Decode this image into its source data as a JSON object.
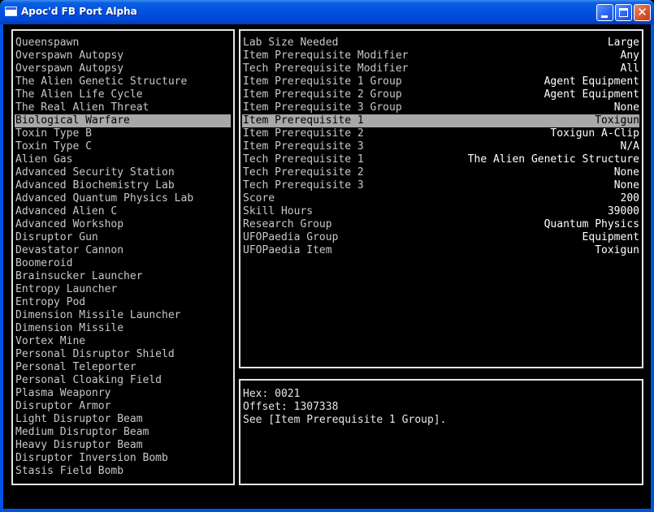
{
  "window": {
    "title": "Apoc'd FB Port Alpha"
  },
  "research_list": {
    "selected_index": 6,
    "items": [
      "Queenspawn",
      "Overspawn Autopsy",
      "Overspawn Autopsy",
      "The Alien Genetic Structure",
      "The Alien Life Cycle",
      "The Real Alien Threat",
      "Biological Warfare",
      "Toxin Type B",
      "Toxin Type C",
      "Alien Gas",
      "Advanced Security Station",
      "Advanced Biochemistry Lab",
      "Advanced Quantum Physics Lab",
      "Advanced Alien C",
      "Advanced Workshop",
      "Disruptor Gun",
      "Devastator Cannon",
      "Boomeroid",
      "Brainsucker Launcher",
      "Entropy Launcher",
      "Entropy Pod",
      "Dimension Missile Launcher",
      "Dimension Missile",
      "Vortex Mine",
      "Personal Disruptor Shield",
      "Personal Teleporter",
      "Personal Cloaking Field",
      "Plasma Weaponry",
      "Disruptor Armor",
      "Light Disruptor Beam",
      "Medium Disruptor Beam",
      "Heavy Disruptor Beam",
      "Disruptor Inversion Bomb",
      "Stasis Field Bomb"
    ]
  },
  "properties": {
    "selected_index": 6,
    "rows": [
      {
        "label": "Lab Size Needed",
        "value": "Large"
      },
      {
        "label": "Item Prerequisite Modifier",
        "value": "Any"
      },
      {
        "label": "Tech Prerequisite Modifier",
        "value": "All"
      },
      {
        "label": "Item Prerequisite 1 Group",
        "value": "Agent Equipment"
      },
      {
        "label": "Item Prerequisite 2 Group",
        "value": "Agent Equipment"
      },
      {
        "label": "Item Prerequisite 3 Group",
        "value": "None"
      },
      {
        "label": "Item Prerequisite 1",
        "value": "Toxigun"
      },
      {
        "label": "Item Prerequisite 2",
        "value": "Toxigun A-Clip"
      },
      {
        "label": "Item Prerequisite 3",
        "value": "N/A"
      },
      {
        "label": "Tech Prerequisite 1",
        "value": "The Alien Genetic Structure"
      },
      {
        "label": "Tech Prerequisite 2",
        "value": "None"
      },
      {
        "label": "Tech Prerequisite 3",
        "value": "None"
      },
      {
        "label": "Score",
        "value": "200"
      },
      {
        "label": "Skill Hours",
        "value": "39000"
      },
      {
        "label": "Research Group",
        "value": "Quantum Physics"
      },
      {
        "label": "UFOPaedia Group",
        "value": "Equipment"
      },
      {
        "label": "UFOPaedia Item",
        "value": "Toxigun"
      }
    ]
  },
  "info": {
    "hex": "Hex: 0021",
    "offset": "Offset: 1307338",
    "description": "See [Item Prerequisite 1 Group]."
  },
  "colors": {
    "background": "#000000",
    "text": "#c8c8c8",
    "selection": "#a8a8a8",
    "border": "#e6e6e6",
    "titlebar": "#0054e3",
    "close_button": "#d8542f"
  },
  "icons": {
    "app": "window-app-icon",
    "minimize": "minimize-icon",
    "maximize": "maximize-icon",
    "close": "close-icon"
  }
}
